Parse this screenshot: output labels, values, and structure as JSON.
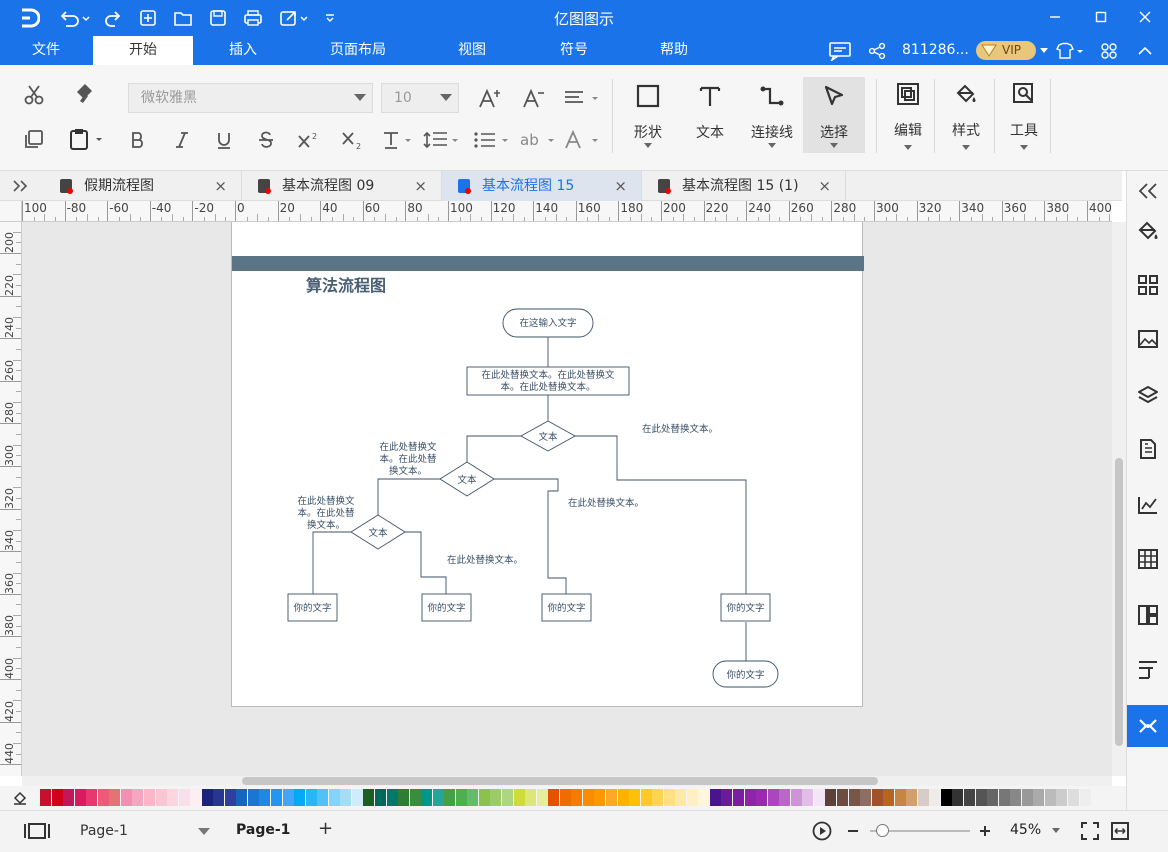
{
  "app": {
    "title": "亿图图示"
  },
  "titlebar": {
    "qat_icons": [
      "logo-icon",
      "undo-icon",
      "redo-icon",
      "new-icon",
      "open-icon",
      "save-icon",
      "print-icon",
      "export-icon",
      "customize-icon"
    ]
  },
  "menus": [
    "文件",
    "开始",
    "插入",
    "页面布局",
    "视图",
    "符号",
    "帮助"
  ],
  "active_menu": "开始",
  "account": {
    "user": "811286...",
    "vip": "VIP"
  },
  "ribbon": {
    "font_name": "微软雅黑",
    "font_size": "10",
    "big_buttons": {
      "shape": "形状",
      "text": "文本",
      "connector": "连接线",
      "select": "选择",
      "edit": "编辑",
      "style": "样式",
      "tools": "工具"
    }
  },
  "tabs": [
    {
      "label": "假期流程图",
      "active": false
    },
    {
      "label": "基本流程图 09",
      "active": false
    },
    {
      "label": "基本流程图 15",
      "active": true
    },
    {
      "label": "基本流程图 15 (1)",
      "active": false
    }
  ],
  "hruler": [
    "100",
    "-80",
    "-60",
    "-40",
    "-20",
    "0",
    "20",
    "40",
    "60",
    "80",
    "100",
    "120",
    "140",
    "160",
    "180",
    "200",
    "220",
    "240",
    "260",
    "280",
    "300",
    "320",
    "340",
    "360",
    "380",
    "400"
  ],
  "vruler": [
    "200",
    "220",
    "240",
    "260",
    "280",
    "300",
    "320",
    "340",
    "360",
    "380",
    "400",
    "420",
    "440"
  ],
  "diagram": {
    "title": "算法流程图",
    "start": "在这输入文字",
    "process1": "在此处替换文本。在此处替换文",
    "process1_line2": "本。在此处替换文本。",
    "decision1": "文本",
    "decision2": "文本",
    "decision3": "文本",
    "note_right": "在此处替换文本。",
    "note_left1_l1": "在此处替换文",
    "note_left1_l2": "本。在此处替",
    "note_left1_l3": "换文本。",
    "note_left2_l1": "在此处替换文",
    "note_left2_l2": "本。在此处替",
    "note_left2_l3": "换文本。",
    "note_mid": "在此处替换文本。",
    "note_bottom": "在此处替换文本。",
    "box1": "你的文字",
    "box2": "你的文字",
    "box3": "你的文字",
    "box4": "你的文字",
    "end": "你的文字"
  },
  "palette_colors": [
    "#c8102e",
    "#d0021b",
    "#c2185b",
    "#d81b60",
    "#e53970",
    "#ef5a7a",
    "#e57373",
    "#f48fb1",
    "#f8a5c2",
    "#fbb6c8",
    "#f9c6d4",
    "#fcd5e0",
    "#f8e0ea",
    "#fdeef3",
    "#1a237e",
    "#283593",
    "#303f9f",
    "#1565c0",
    "#1976d2",
    "#1e88e5",
    "#2196f3",
    "#42a5f5",
    "#03a9f4",
    "#29b6f6",
    "#4fc3f7",
    "#81d4fa",
    "#a7dcf5",
    "#d0ecf8",
    "#1b5e20",
    "#00695c",
    "#00796b",
    "#2e7d32",
    "#388e3c",
    "#009688",
    "#26a69a",
    "#43a047",
    "#4caf50",
    "#66bb6a",
    "#8bc34a",
    "#9ccc65",
    "#aed581",
    "#cddc39",
    "#dce775",
    "#e6ee9c",
    "#e65100",
    "#ef6c00",
    "#f57c00",
    "#fb8c00",
    "#ff9800",
    "#ffa726",
    "#ffb300",
    "#ffc107",
    "#ffca28",
    "#ffd54f",
    "#ffe082",
    "#ffe9a8",
    "#fff0c4",
    "#fff6dd",
    "#4a148c",
    "#6a1b9a",
    "#7b1fa2",
    "#8e24aa",
    "#9c27b0",
    "#ab47bc",
    "#ba68c8",
    "#ce93d8",
    "#e1bee7",
    "#f3e5f5",
    "#5d4037",
    "#6d4c41",
    "#795548",
    "#8d6e63",
    "#a0522d",
    "#b5651d",
    "#c68642",
    "#d2a06a",
    "#d7ccc8",
    "#efebe9",
    "#000000",
    "#333333",
    "#444444",
    "#555555",
    "#666666",
    "#777777",
    "#888888",
    "#999999",
    "#aaaaaa",
    "#bbbbbb",
    "#cccccc",
    "#dddddd",
    "#eeeeee"
  ],
  "status": {
    "page_select": "Page-1",
    "page_tab": "Page-1",
    "add": "+",
    "zoom": "45%",
    "zoom_fraction": 0.12
  }
}
